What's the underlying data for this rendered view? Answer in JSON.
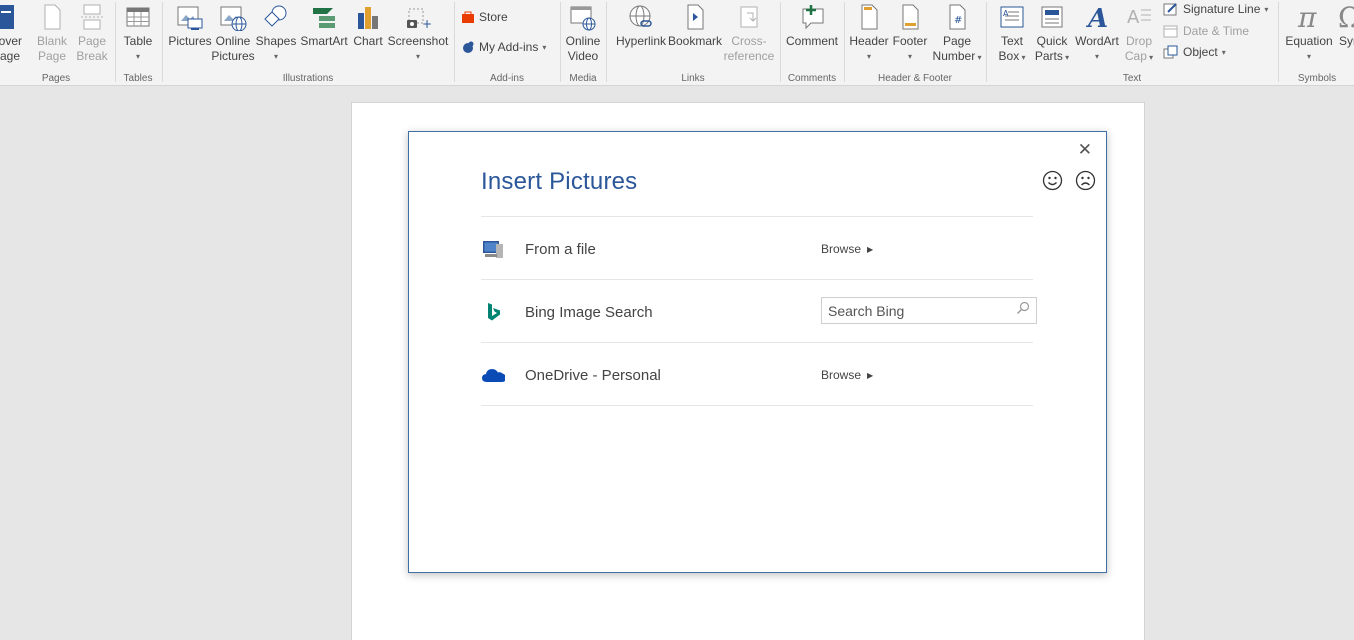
{
  "ribbon": {
    "pages": {
      "label": "Pages",
      "cover_l1": "Cover",
      "cover_l2": "Page",
      "blank_l1": "Blank",
      "blank_l2": "Page",
      "break_l1": "Page",
      "break_l2": "Break"
    },
    "tables": {
      "label": "Tables",
      "table": "Table"
    },
    "illustrations": {
      "label": "Illustrations",
      "pictures": "Pictures",
      "online_l1": "Online",
      "online_l2": "Pictures",
      "shapes": "Shapes",
      "smartart": "SmartArt",
      "chart": "Chart",
      "screenshot": "Screenshot"
    },
    "addins": {
      "label": "Add-ins",
      "store": "Store",
      "my_addins": "My Add-ins"
    },
    "media": {
      "label": "Media",
      "video_l1": "Online",
      "video_l2": "Video"
    },
    "links": {
      "label": "Links",
      "hyperlink": "Hyperlink",
      "bookmark": "Bookmark",
      "cross_l1": "Cross-",
      "cross_l2": "reference"
    },
    "comments": {
      "label": "Comments",
      "comment": "Comment"
    },
    "header_footer": {
      "label": "Header & Footer",
      "header": "Header",
      "footer": "Footer",
      "pagenum_l1": "Page",
      "pagenum_l2": "Number"
    },
    "text": {
      "label": "Text",
      "textbox_l1": "Text",
      "textbox_l2": "Box",
      "quick_l1": "Quick",
      "quick_l2": "Parts",
      "wordart": "WordArt",
      "drop_l1": "Drop",
      "drop_l2": "Cap",
      "signature": "Signature Line",
      "datetime": "Date & Time",
      "object": "Object"
    },
    "symbols": {
      "label": "Symbols",
      "equation": "Equation",
      "symbol_partial": "Sym"
    }
  },
  "dialog": {
    "title": "Insert Pictures",
    "rows": [
      {
        "label": "From a file",
        "action": "Browse"
      },
      {
        "label": "Bing Image Search",
        "placeholder": "Search Bing"
      },
      {
        "label": "OneDrive - Personal",
        "action": "Browse"
      }
    ]
  },
  "icons": {
    "close": "close-icon",
    "smile": "smile-icon",
    "frown": "frown-icon",
    "computer": "computer-icon",
    "bing": "bing-icon",
    "onedrive": "onedrive-cloud-icon",
    "search": "search-icon"
  },
  "colors": {
    "accent": "#2b579a",
    "bing": "#008373",
    "onedrive": "#0a4bb5"
  }
}
